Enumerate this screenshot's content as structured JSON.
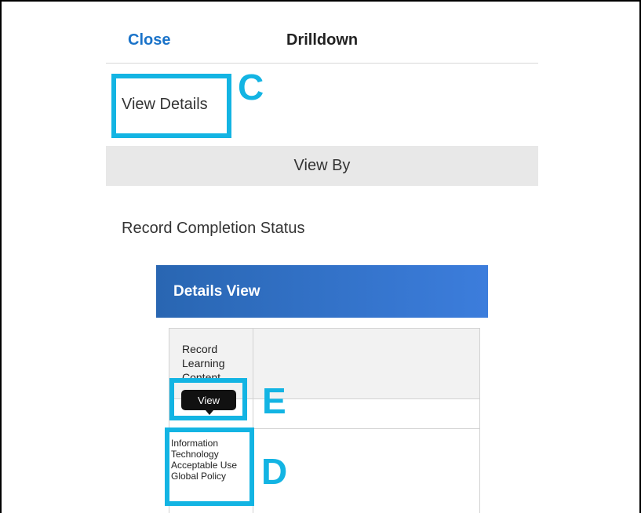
{
  "header": {
    "close_label": "Close",
    "title": "Drilldown"
  },
  "view_details_label": "View Details",
  "view_by_label": "View By",
  "record_status_label": "Record Completion Status",
  "details_view": {
    "title": "Details View",
    "column_header": "Record Learning Content",
    "tooltip_text": "View",
    "row_value": "Information Technology Acceptable Use Global Policy"
  },
  "annotations": {
    "c": "C",
    "d": "D",
    "e": "E"
  },
  "colors": {
    "accent_link": "#1a73c9",
    "annotation": "#13b4e3",
    "header_start": "#2966b2",
    "header_end": "#3c7ddc"
  }
}
